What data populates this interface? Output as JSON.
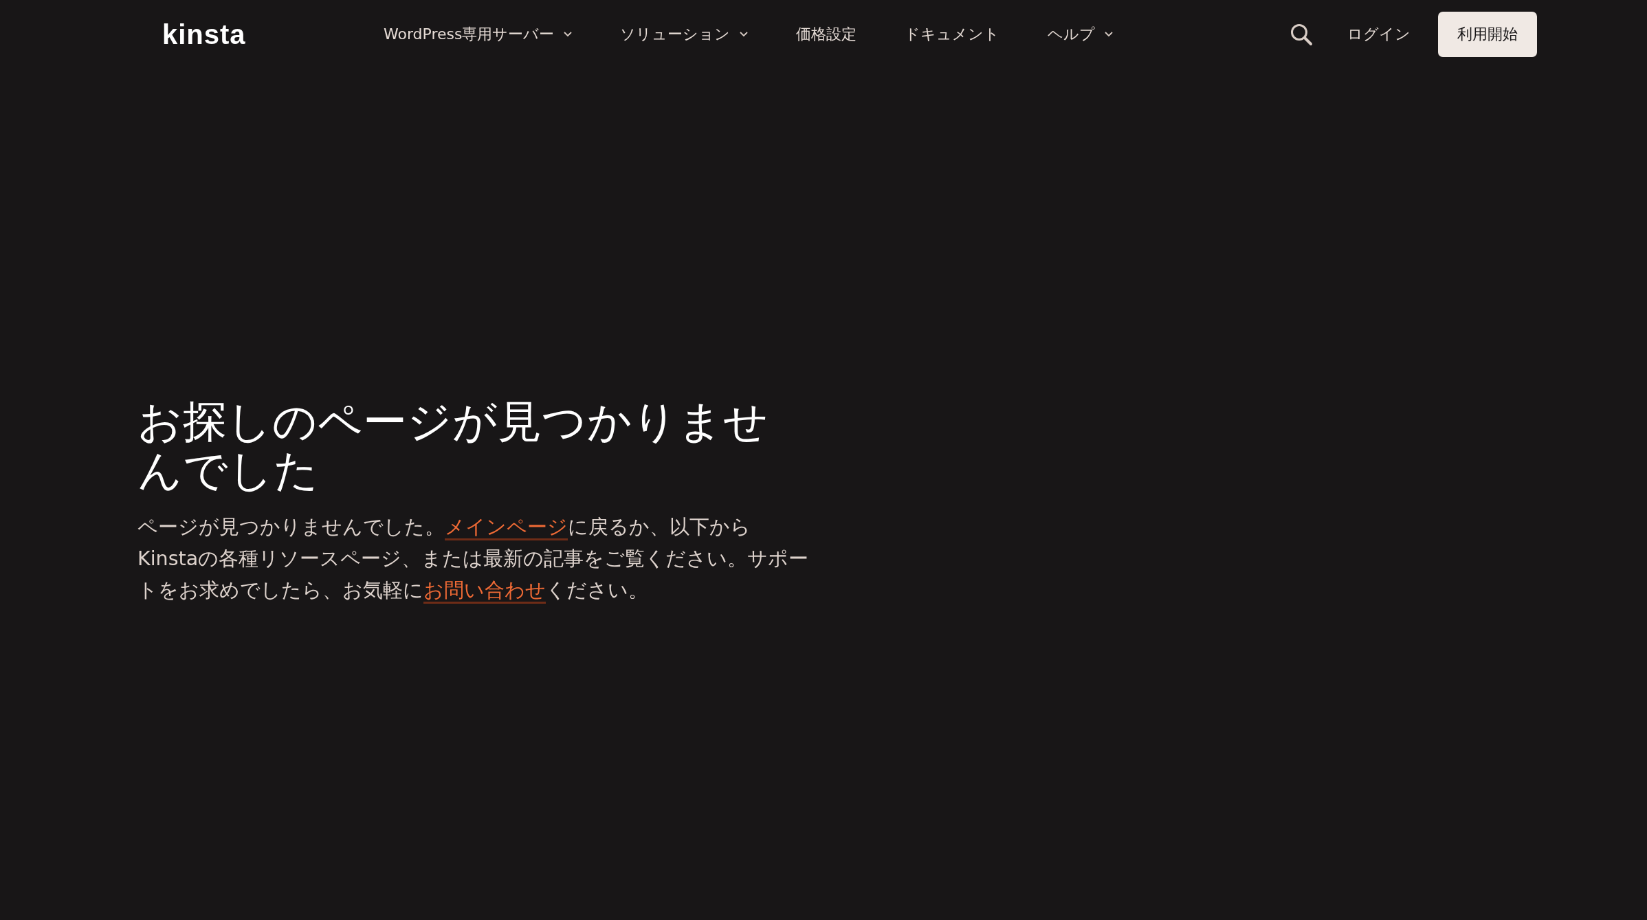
{
  "header": {
    "logo": "kinsta",
    "nav": [
      {
        "label": "WordPress専用サーバー",
        "dropdown": true
      },
      {
        "label": "ソリューション",
        "dropdown": true
      },
      {
        "label": "価格設定",
        "dropdown": false
      },
      {
        "label": "ドキュメント",
        "dropdown": false
      },
      {
        "label": "ヘルプ",
        "dropdown": true
      }
    ],
    "login": "ログイン",
    "cta": "利用開始"
  },
  "content": {
    "heading": "お探しのページが見つかりませんでした",
    "paragraph": [
      {
        "kind": "text",
        "text": "ページが見つかりませんでした。"
      },
      {
        "kind": "link",
        "text": "メインページ"
      },
      {
        "kind": "text",
        "text": "に戻るか、以下からKinstaの各種リソースページ、または最新の記事をご覧ください。サポートをお求めでしたら、お気軽に"
      },
      {
        "kind": "link",
        "text": "お問い合わせ"
      },
      {
        "kind": "text",
        "text": "ください。"
      }
    ]
  }
}
